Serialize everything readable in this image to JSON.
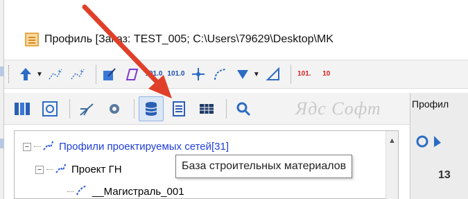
{
  "window": {
    "title": "Профиль [Заказ: TEST_005; C:\\Users\\79629\\Desktop\\MK"
  },
  "toolbar1": {
    "num_icon_1": "101.0",
    "num_icon_2": "101.0",
    "num_icon_3": "101.",
    "num_icon_4": "10"
  },
  "toolbar2": {
    "watermark": "Ядс Софт"
  },
  "tooltip": {
    "text": "База строительных материалов"
  },
  "right_pane": {
    "tab_label": "Профил",
    "number": "13"
  },
  "tree": {
    "root_label": "Профили проектируемых сетей[31]",
    "project_label": "Проект ГН",
    "main_label": "__Магистраль_001"
  },
  "colors": {
    "arrow": "#e0402a",
    "link": "#1f3fd8",
    "active_button": "#dbe7f6"
  }
}
